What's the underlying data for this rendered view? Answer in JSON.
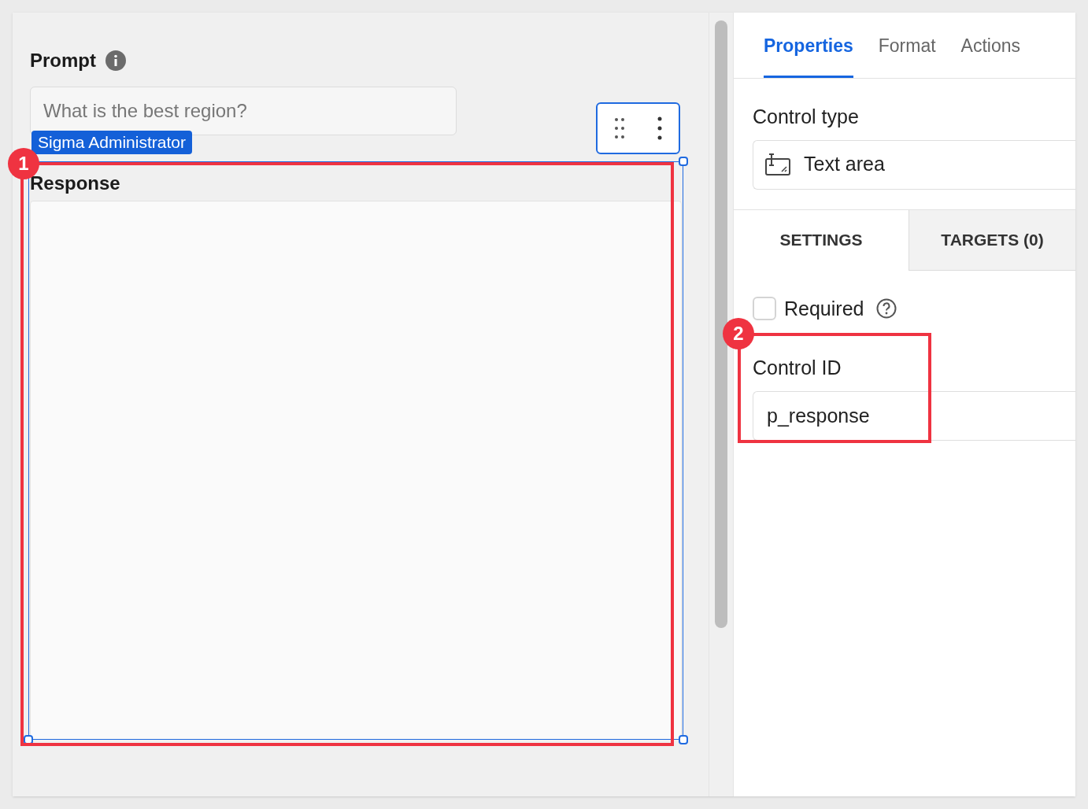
{
  "canvas": {
    "prompt": {
      "label": "Prompt",
      "placeholder": "What is the best region?",
      "user_tag": "Sigma Administrator"
    },
    "response": {
      "label": "Response",
      "selected": true
    }
  },
  "panel": {
    "tabs": [
      {
        "label": "Properties",
        "selected": true
      },
      {
        "label": "Format",
        "selected": false
      },
      {
        "label": "Actions",
        "selected": false
      }
    ],
    "control_type": {
      "label": "Control type",
      "value": "Text area"
    },
    "subtabs": [
      {
        "label": "SETTINGS",
        "selected": true
      },
      {
        "label": "TARGETS (0)",
        "selected": false
      }
    ],
    "required": {
      "label": "Required",
      "checked": false
    },
    "control_id": {
      "label": "Control ID",
      "value": "p_response"
    }
  },
  "annotations": [
    {
      "number": "1"
    },
    {
      "number": "2"
    }
  ]
}
